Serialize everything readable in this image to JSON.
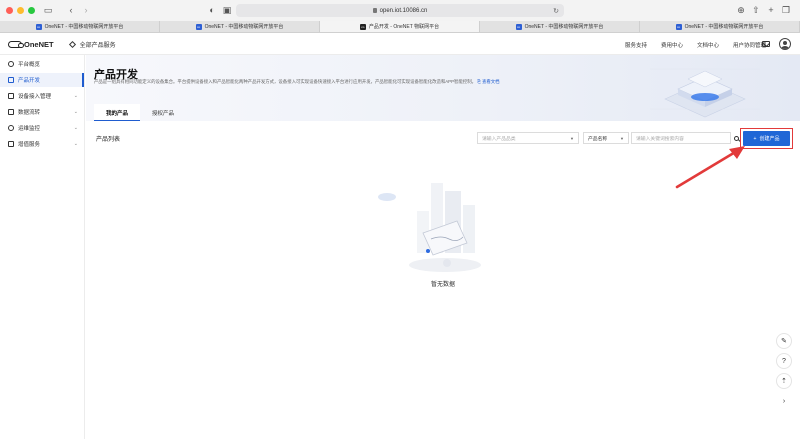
{
  "browser": {
    "url": "open.iot.10086.cn",
    "tabs": [
      {
        "label": "OneNET - 中国移动物联网开放平台",
        "favicon": "onenet-favicon",
        "active": false
      },
      {
        "label": "OneNET - 中国移动物联网开放平台",
        "favicon": "onenet-favicon",
        "active": false
      },
      {
        "label": "产品开发 - OneNET 物联网平台",
        "favicon": "onenet-favicon-dark",
        "active": true
      },
      {
        "label": "OneNET - 中国移动物联网开放平台",
        "favicon": "onenet-favicon",
        "active": false
      },
      {
        "label": "OneNET - 中国移动物联网开放平台",
        "favicon": "onenet-favicon",
        "active": false
      }
    ]
  },
  "header": {
    "logo_text": "OneNET",
    "all_products": "全部产品服务",
    "nav": [
      "服务支持",
      "费用中心",
      "文档中心",
      "用户协同管理"
    ]
  },
  "sidebar": {
    "items": [
      {
        "label": "平台概览",
        "icon": "overview-icon",
        "active": false,
        "chevron": false
      },
      {
        "label": "产品开发",
        "icon": "product-icon",
        "active": true,
        "chevron": false
      },
      {
        "label": "设备接入管理",
        "icon": "device-icon",
        "active": false,
        "chevron": true
      },
      {
        "label": "数据流转",
        "icon": "dataflow-icon",
        "active": false,
        "chevron": true
      },
      {
        "label": "运维监控",
        "icon": "monitor-icon",
        "active": false,
        "chevron": true
      },
      {
        "label": "增值服务",
        "icon": "service-icon",
        "active": false,
        "chevron": true
      }
    ]
  },
  "page": {
    "title": "产品开发",
    "description": "产品是一组具有相同功能定义的设备集合。平台提供设备接入和产品智能化两种产品开发方式，设备接入可实现设备快速接入平台进行应用开发，产品智能化可实现设备智能化改造和APP智能控制。",
    "doc_link": "查看文档",
    "tabs": [
      "我的产品",
      "授权产品"
    ],
    "active_tab": 0
  },
  "toolbar": {
    "list_title": "产品列表",
    "category_placeholder": "请输入产品品类",
    "search_type": "产品名称",
    "keyword_placeholder": "请输入关键词搜索内容",
    "create_label": "创建产品",
    "create_icon": "plus-icon"
  },
  "empty_state": {
    "text": "暂无数据"
  },
  "colors": {
    "primary": "#1f66d6",
    "highlight": "#e23a3a",
    "sidebar_active_bg": "#eef2fb"
  }
}
